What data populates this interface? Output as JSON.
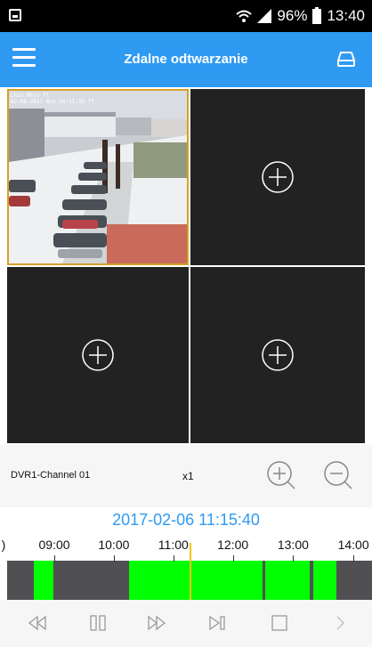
{
  "status_bar": {
    "battery": "96%",
    "time": "13:40"
  },
  "app_bar": {
    "title": "Zdalne odtwarzanie"
  },
  "grid": {
    "tile1": {
      "osd_line1": "Lhin Rhjx fl",
      "osd_line2": "02-06-2017 Mon 10:11:35 ff"
    }
  },
  "info_bar": {
    "channel": "DVR1-Channel 01",
    "speed": "x1"
  },
  "timeline": {
    "datetime": "2017-02-06 11:15:40",
    "hours": [
      {
        "label": "09:00",
        "pos": 0.146
      },
      {
        "label": "10:00",
        "pos": 0.306
      },
      {
        "label": "11:00",
        "pos": 0.466
      },
      {
        "label": "12:00",
        "pos": 0.626
      },
      {
        "label": "13:00",
        "pos": 0.788
      },
      {
        "label": "14:00",
        "pos": 0.95
      }
    ],
    "recordings": [
      {
        "start": 0.073,
        "end": 0.128
      },
      {
        "start": 0.334,
        "end": 0.7
      },
      {
        "start": 0.708,
        "end": 0.83
      },
      {
        "start": 0.84,
        "end": 0.902
      }
    ]
  },
  "colors": {
    "accent": "#2f9af2",
    "recording": "#00ff00",
    "cursor": "#f5c518",
    "selected_border": "#d4a227"
  }
}
